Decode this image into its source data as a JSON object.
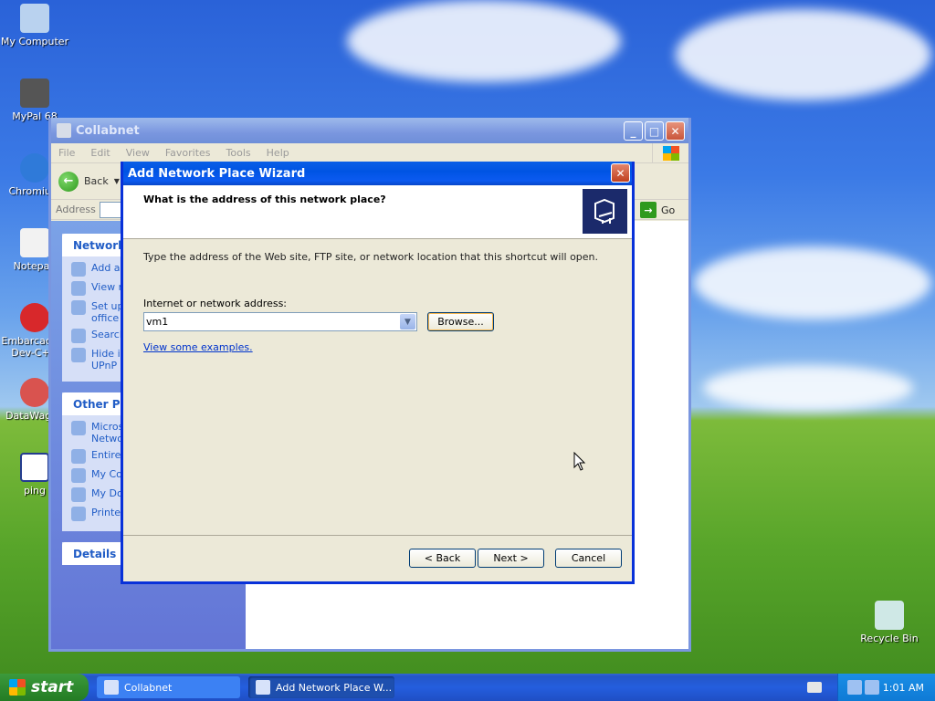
{
  "desktop": {
    "icons": [
      {
        "label": "My Computer",
        "icon": "my-computer-icon"
      },
      {
        "label": "MyPal 68",
        "icon": "mypal-icon"
      },
      {
        "label": "Chromium",
        "icon": "chromium-icon"
      },
      {
        "label": "Notepad",
        "icon": "notepad-icon"
      },
      {
        "label": "Embarcadero Dev-C++",
        "icon": "devcpp-icon"
      },
      {
        "label": "DataWagon",
        "icon": "datawagon-icon"
      },
      {
        "label": "ping",
        "icon": "ping-icon"
      },
      {
        "label": "Recycle Bin",
        "icon": "recycle-bin-icon"
      }
    ]
  },
  "explorer": {
    "title": "Collabnet",
    "menu": [
      "File",
      "Edit",
      "View",
      "Favorites",
      "Tools",
      "Help"
    ],
    "back_label": "Back",
    "address_label": "Address",
    "go_label": "Go",
    "network_tasks_header": "Network Tasks",
    "network_tasks": [
      "Add a network place",
      "View network connections",
      "Set up a home or small office network",
      "Search Active Directory",
      "Hide icons for networked UPnP devices"
    ],
    "other_places_header": "Other Places",
    "other_places": [
      "Microsoft Windows Network",
      "Entire Network",
      "My Computer",
      "My Documents",
      "Printers and Faxes"
    ],
    "details_header": "Details"
  },
  "wizard": {
    "title": "Add Network Place Wizard",
    "question": "What is the address of this network place?",
    "description": "Type the address of the Web site, FTP site, or network location that this shortcut will open.",
    "address_label": "Internet or network address:",
    "address_value": "vm1",
    "browse_label": "Browse...",
    "examples_link": "View some examples.",
    "back_label": "< Back",
    "next_label": "Next >",
    "cancel_label": "Cancel"
  },
  "taskbar": {
    "start_label": "start",
    "items": [
      "Collabnet",
      "Add Network Place W..."
    ],
    "clock": "1:01 AM"
  },
  "colors": {
    "xp_blue": "#0054e3",
    "link_blue": "#215dc6",
    "dialog_bg": "#ece9d8"
  }
}
